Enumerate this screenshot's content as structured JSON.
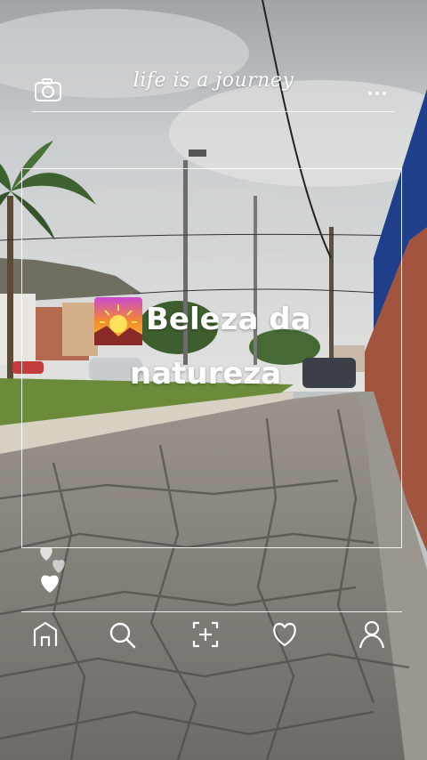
{
  "header": {
    "title": "life is a journey"
  },
  "post": {
    "caption_line1": "Beleza da",
    "caption_line2": "natureza"
  },
  "icons": {
    "camera": "camera-icon",
    "more": "more-dots-icon",
    "hearts": "hearts-icon",
    "home": "home-icon",
    "search": "search-icon",
    "add": "add-icon",
    "like": "heart-icon",
    "profile": "profile-icon",
    "sunset_emoji": "sunset-icon"
  },
  "colors": {
    "overlay": "#ffffff",
    "sky": "#c9cdcf",
    "grass": "#6b8b3a",
    "pavement": "#8a8580"
  }
}
